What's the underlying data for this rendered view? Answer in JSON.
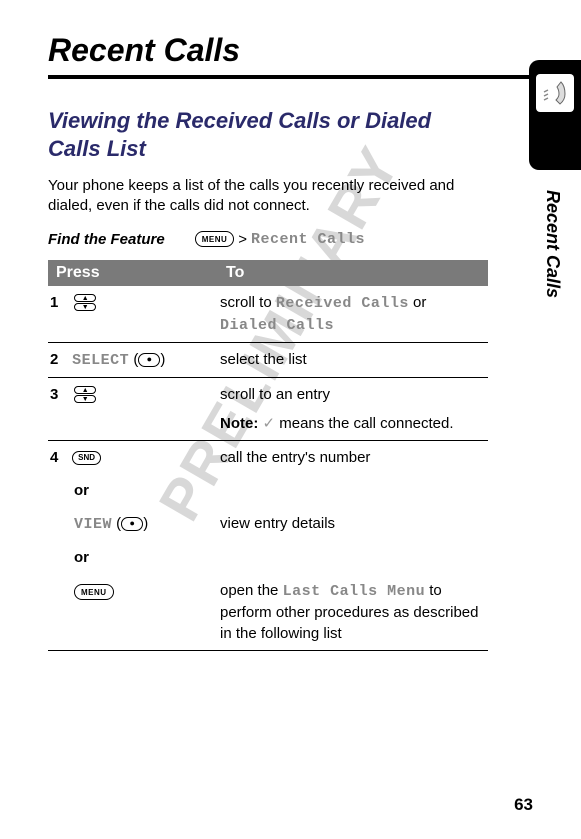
{
  "page": {
    "title": "Recent Calls",
    "subtitle": "Viewing the Received Calls or Dialed Calls List",
    "intro": "Your phone keeps a list of the calls you recently received and dialed, even if the calls did not connect.",
    "watermark": "PRELIMINARY",
    "page_number": "63",
    "side_label": "Recent Calls"
  },
  "feature": {
    "label": "Find the Feature",
    "menu_key": "MENU",
    "separator": ">",
    "path": "Recent Calls"
  },
  "table": {
    "headers": {
      "press": "Press",
      "to": "To"
    },
    "rows": {
      "r1": {
        "num": "1",
        "to_pre": "scroll to ",
        "to_mono1": "Received Calls",
        "to_mid": " or ",
        "to_mono2": "Dialed Calls"
      },
      "r2": {
        "num": "2",
        "press_label": "SELECT",
        "to": "select the list"
      },
      "r3": {
        "num": "3",
        "to": "scroll to an entry",
        "note_label": "Note:",
        "note_text": " means the call connected."
      },
      "r4": {
        "num": "4",
        "snd": "SND",
        "to_a": "call the entry's number",
        "or": "or",
        "view_label": "VIEW",
        "to_b": "view entry details",
        "menu_key": "MENU",
        "to_c_pre": "open the ",
        "to_c_mono": "Last Calls Menu",
        "to_c_post": " to perform other procedures as described in the following list"
      }
    }
  }
}
